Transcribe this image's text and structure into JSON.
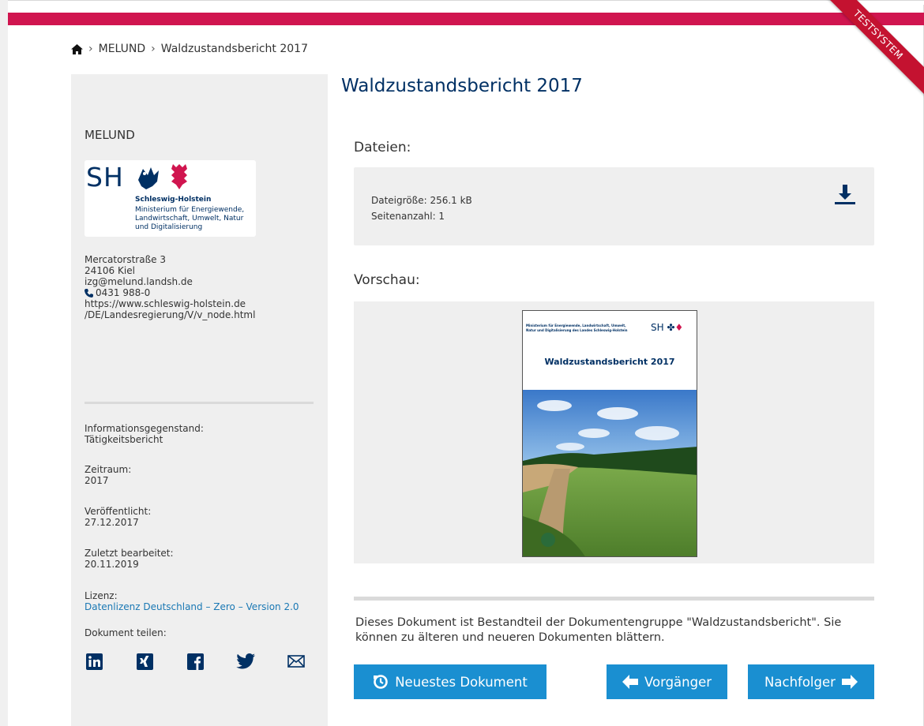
{
  "banner": {
    "ribbon_label": "TESTSYSTEM"
  },
  "breadcrumb": {
    "home_icon": "home-icon",
    "items": [
      "MELUND",
      "Waldzustandsbericht 2017"
    ]
  },
  "sidebar": {
    "org_title": "MELUND",
    "logo": {
      "sh": "SH",
      "name": "Schleswig-Holstein",
      "ministry": "Ministerium für Energiewende, Landwirtschaft, Umwelt, Natur und Digitalisierung"
    },
    "address": {
      "street": "Mercatorstraße 3",
      "city": "24106 Kiel",
      "email": "izg@melund.landsh.de",
      "phone": "0431 988-0",
      "url_line1": "https://www.schleswig-holstein.de",
      "url_line2": "/DE/Landesregierung/V/v_node.html"
    },
    "meta": {
      "subject_label": "Informationsgegenstand:",
      "subject_value": "Tätigkeitsbericht",
      "period_label": "Zeitraum:",
      "period_value": "2017",
      "published_label": "Veröffentlicht:",
      "published_value": "27.12.2017",
      "edited_label": "Zuletzt bearbeitet:",
      "edited_value": "20.11.2019",
      "license_label": "Lizenz:",
      "license_value": "Datenlizenz Deutschland – Zero – Version 2.0",
      "share_label": "Dokument teilen:"
    },
    "share_icons": [
      "linkedin-icon",
      "xing-icon",
      "facebook-icon",
      "twitter-icon",
      "mail-icon"
    ]
  },
  "main": {
    "title": "Waldzustandsbericht 2017",
    "files_heading": "Dateien:",
    "file_size": "Dateigröße: 256.1 kB",
    "page_count": "Seitenanzahl: 1",
    "preview_heading": "Vorschau:",
    "cover": {
      "ministry": "Ministerium für Energiewende, Landwirtschaft, Umwelt, Natur und Digitalisierung des Landes Schleswig-Holstein",
      "sh": "SH",
      "title": "Waldzustandsbericht 2017"
    },
    "description": "Dieses Dokument ist Bestandteil der Dokumentengruppe \"Waldzustandsbericht\". Sie können zu älteren und neueren Dokumenten blättern.",
    "buttons": {
      "newest": "Neuestes Dokument",
      "prev": "Vorgänger",
      "next": "Nachfolger"
    }
  },
  "colors": {
    "brand_red": "#d0154f",
    "navy": "#003064",
    "button_blue": "#1a8fd1",
    "link_blue": "#1a78b4",
    "panel_grey": "#efefef"
  }
}
